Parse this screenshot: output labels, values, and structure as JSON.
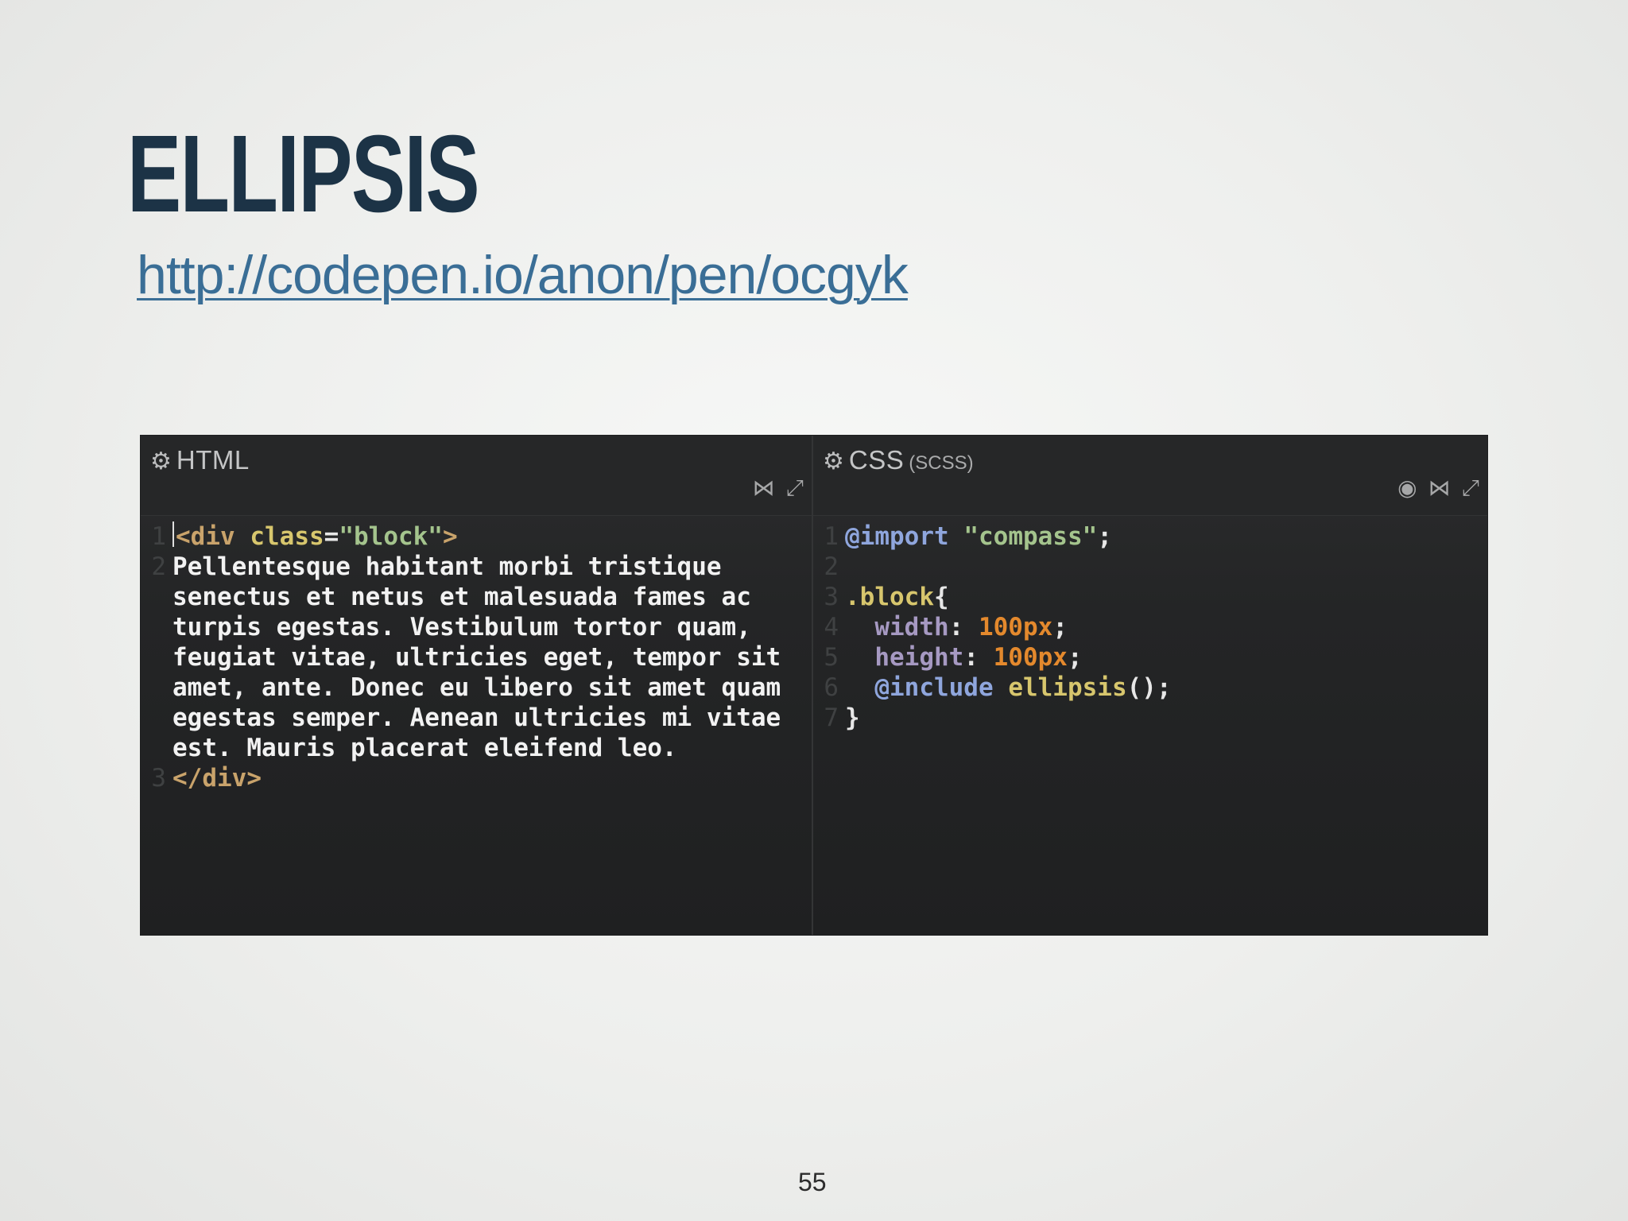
{
  "slide": {
    "title": "ELLIPSIS",
    "link": "http://codepen.io/anon/pen/ocgyk",
    "page_number": "55"
  },
  "editor": {
    "html_pane": {
      "title": "HTML",
      "icons": [
        "gear-icon",
        "collapse-icon",
        "expand-icon"
      ],
      "lines": [
        {
          "n": "1",
          "tag_open": "<div ",
          "attr": "class",
          "eq": "=",
          "str": "\"block\"",
          "tag_close": ">"
        },
        {
          "n": "2",
          "text": "Pellentesque habitant morbi tristique"
        },
        {
          "n": "",
          "text": "senectus et netus et malesuada fames ac"
        },
        {
          "n": "",
          "text": "turpis egestas. Vestibulum tortor quam,"
        },
        {
          "n": "",
          "text": "feugiat vitae, ultricies eget, tempor sit"
        },
        {
          "n": "",
          "text": "amet, ante. Donec eu libero sit amet quam"
        },
        {
          "n": "",
          "text": "egestas semper. Aenean ultricies mi vitae"
        },
        {
          "n": "",
          "text": "est. Mauris placerat eleifend leo."
        },
        {
          "n": "3",
          "tag": "</div>"
        }
      ]
    },
    "css_pane": {
      "title": "CSS",
      "subtitle": "(SCSS)",
      "icons": [
        "gear-icon",
        "eye-icon",
        "collapse-icon",
        "expand-icon"
      ],
      "lines": [
        {
          "n": "1",
          "kw": "@import",
          "sp": " ",
          "str": "\"compass\"",
          "punc": ";"
        },
        {
          "n": "2"
        },
        {
          "n": "3",
          "sel": ".block",
          "punc": "{"
        },
        {
          "n": "4",
          "indent": "  ",
          "prop": "width",
          "colon": ": ",
          "num": "100px",
          "punc": ";"
        },
        {
          "n": "5",
          "indent": "  ",
          "prop": "height",
          "colon": ": ",
          "num": "100px",
          "punc": ";"
        },
        {
          "n": "6",
          "indent": "  ",
          "kw": "@include",
          "sp": " ",
          "fn": "ellipsis",
          "paren": "()",
          "punc": ";"
        },
        {
          "n": "7",
          "punc": "}"
        }
      ]
    }
  }
}
